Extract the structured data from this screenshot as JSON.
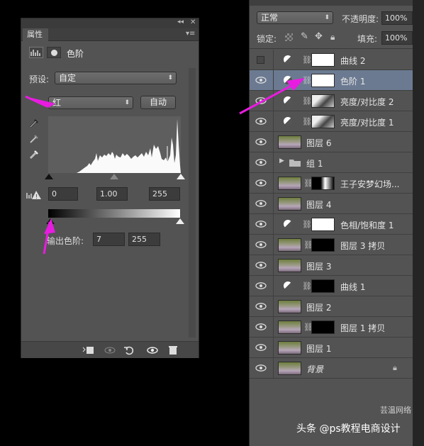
{
  "properties": {
    "tab_label": "属性",
    "panel_title": "色阶",
    "preset_label": "预设:",
    "preset_value": "自定",
    "channel_value": "红",
    "auto_button": "自动",
    "input_black": "0",
    "input_gamma": "1.00",
    "input_white": "255",
    "output_label": "输出色阶:",
    "output_black": "7",
    "output_white": "255"
  },
  "layers_panel": {
    "blend_mode": "正常",
    "opacity_label": "不透明度:",
    "opacity_value": "100%",
    "lock_label": "锁定:",
    "fill_label": "填充:",
    "fill_value": "100%",
    "layers": [
      {
        "name": "曲线 2",
        "kind": "adjustment",
        "visible": false
      },
      {
        "name": "色阶 1",
        "kind": "adjustment",
        "visible": true,
        "selected": true
      },
      {
        "name": "亮度/对比度 2",
        "kind": "adjustment",
        "visible": true
      },
      {
        "name": "亮度/对比度 1",
        "kind": "adjustment",
        "visible": true
      },
      {
        "name": "图层 6",
        "kind": "pixel",
        "visible": true
      },
      {
        "name": "组 1",
        "kind": "group",
        "visible": true
      },
      {
        "name": "王子安梦幻场...",
        "kind": "pixel-mask",
        "visible": true
      },
      {
        "name": "图层 4",
        "kind": "pixel",
        "visible": true
      },
      {
        "name": "色相/饱和度 1",
        "kind": "adjustment",
        "visible": true
      },
      {
        "name": "图层 3 拷贝",
        "kind": "pixel-mask",
        "visible": true
      },
      {
        "name": "图层 3",
        "kind": "pixel",
        "visible": true
      },
      {
        "name": "曲线 1",
        "kind": "adjustment-black",
        "visible": true
      },
      {
        "name": "图层 2",
        "kind": "pixel",
        "visible": true
      },
      {
        "name": "图层 1 拷贝",
        "kind": "pixel-mask",
        "visible": true
      },
      {
        "name": "图层 1",
        "kind": "pixel",
        "visible": true
      },
      {
        "name": "背景",
        "kind": "background",
        "visible": true
      }
    ]
  },
  "watermark": {
    "text1": "头条 @ps教程电商设计",
    "text2": "芸温网络"
  },
  "colors": {
    "panel_bg": "#535353",
    "selected_row": "#6b7a91",
    "arrow_magenta": "#e81ce0"
  }
}
